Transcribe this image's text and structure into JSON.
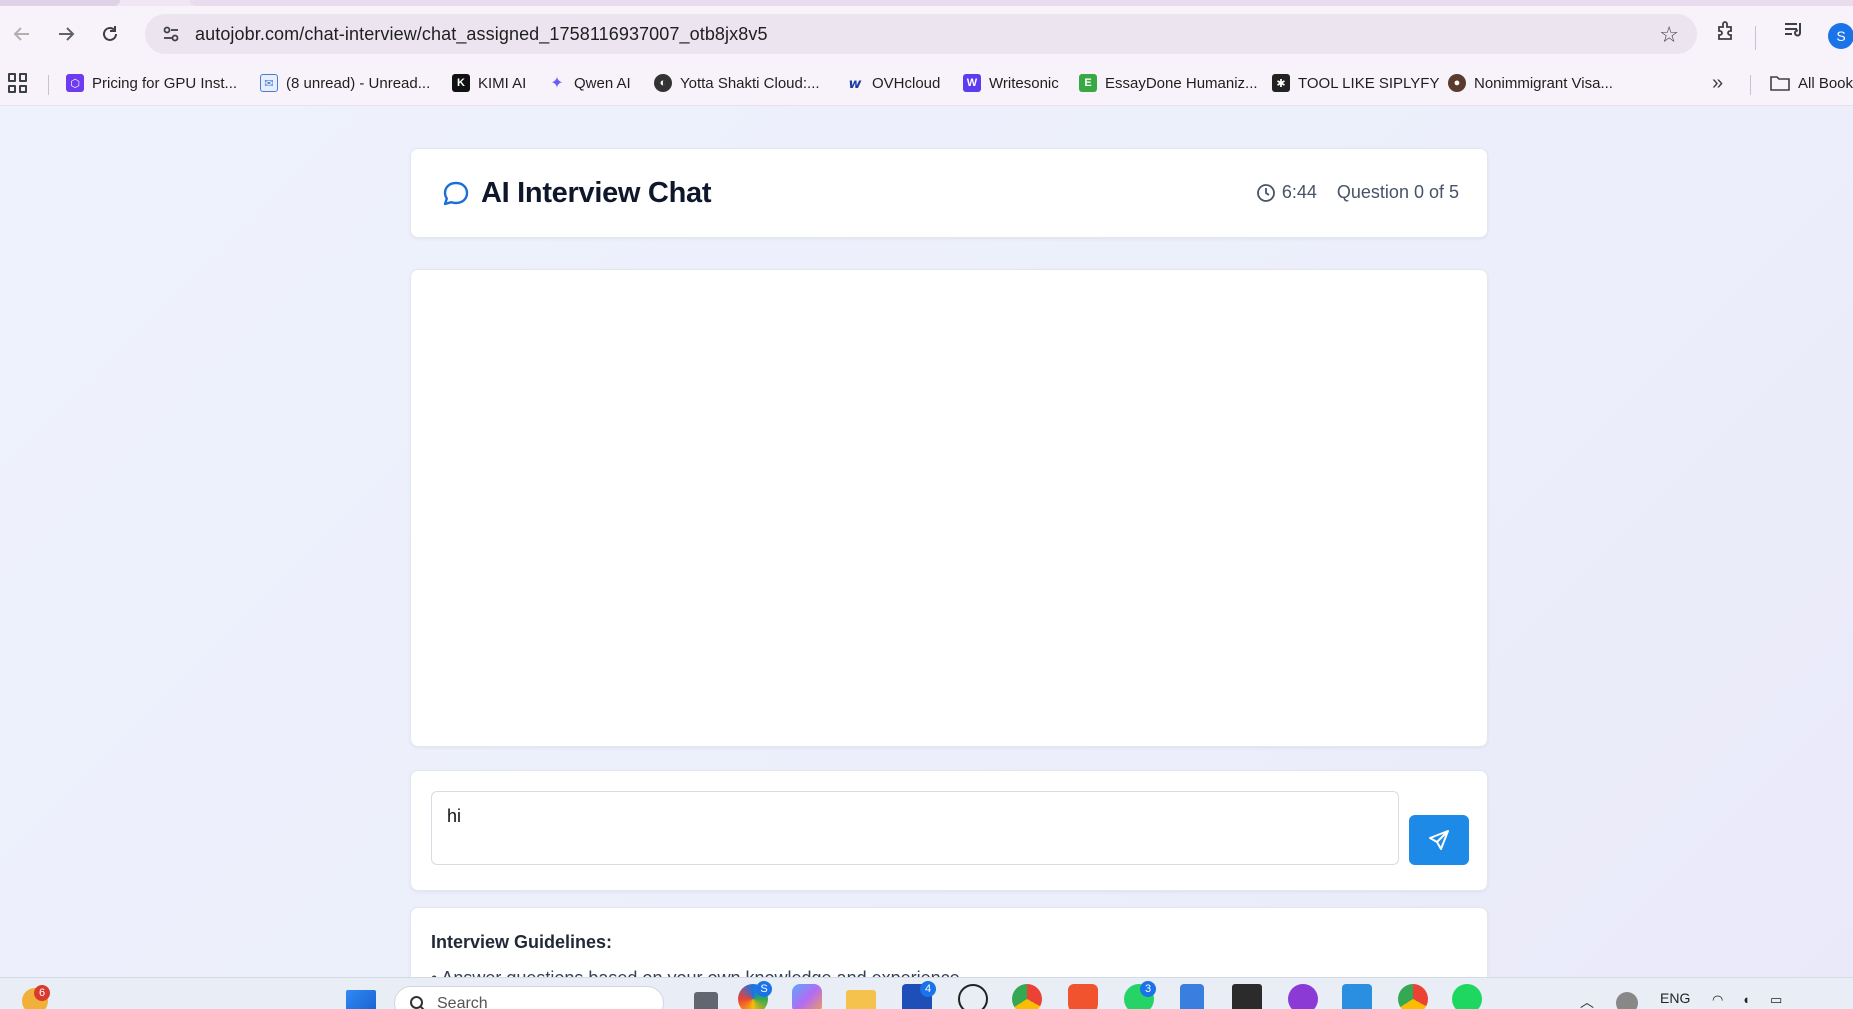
{
  "browser": {
    "url": "autojobr.com/chat-interview/chat_assigned_1758116937007_otb8jx8v5",
    "profile_initial": "S",
    "bookmarks": [
      {
        "label": "Pricing for GPU Inst...",
        "color": "#6e3cf0"
      },
      {
        "label": "(8 unread) - Unread...",
        "color": "#4a7bd8"
      },
      {
        "label": "KIMI AI",
        "color": "#111111"
      },
      {
        "label": "Qwen AI",
        "color": "#6a5cf5"
      },
      {
        "label": "Yotta Shakti Cloud:...",
        "color": "#333333"
      },
      {
        "label": "OVHcloud",
        "color": "#1b3fa0"
      },
      {
        "label": "Writesonic",
        "color": "#5b3cf0"
      },
      {
        "label": "EssayDone Humaniz...",
        "color": "#38a845"
      },
      {
        "label": "TOOL LIKE SIPLYFY",
        "color": "#222222"
      },
      {
        "label": "Nonimmigrant Visa...",
        "color": "#5a3b2e"
      }
    ],
    "all_bookmarks_label": "All Book"
  },
  "header": {
    "title": "AI Interview Chat",
    "timer": "6:44",
    "progress": "Question 0 of 5"
  },
  "composer": {
    "value": "hi"
  },
  "guidelines": {
    "title": "Interview Guidelines:",
    "items": [
      "• Answer questions based on your own knowledge and experience"
    ]
  },
  "taskbar": {
    "search_placeholder": "Search",
    "language": "ENG",
    "badges": {
      "widgets": "6",
      "edge": "S",
      "app1": "4",
      "whatsapp": "3"
    }
  },
  "colors": {
    "accent": "#1c8ae6",
    "page_bg": "#eef1fb"
  }
}
